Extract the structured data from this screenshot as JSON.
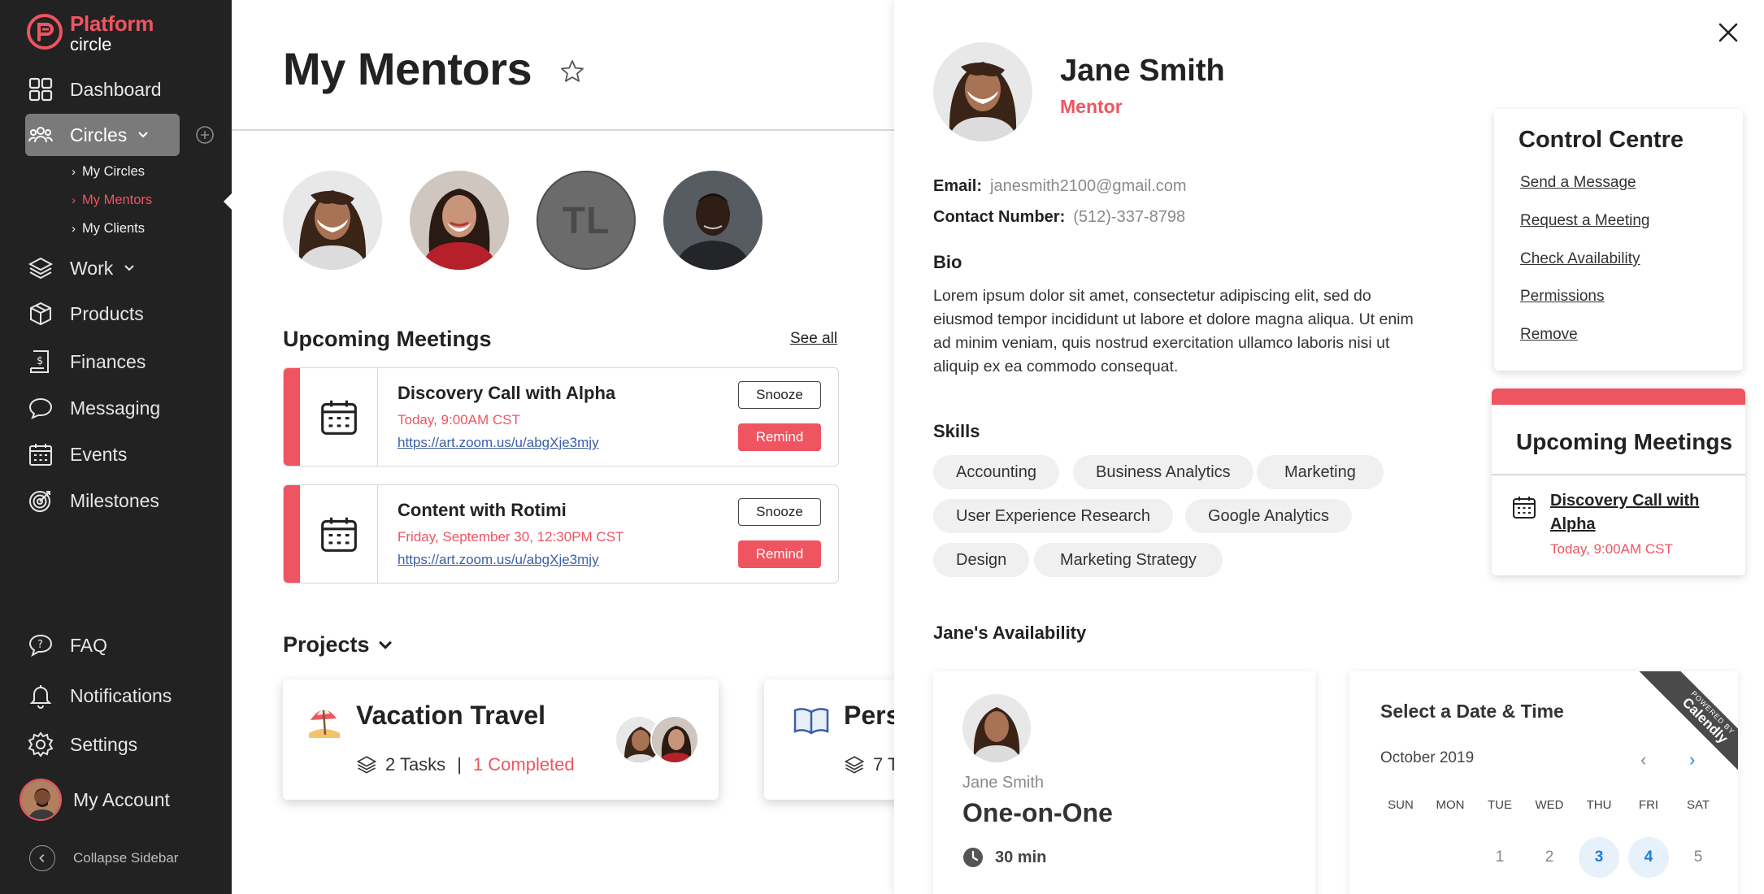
{
  "brand": {
    "name_line1": "Platform",
    "name_line2": "circle",
    "accent": "#ef5461"
  },
  "sidebar": {
    "items": [
      {
        "label": "Dashboard",
        "icon": "dashboard-icon"
      },
      {
        "label": "Circles",
        "icon": "people-icon"
      },
      {
        "label": "Work",
        "icon": "layers-icon"
      },
      {
        "label": "Products",
        "icon": "box-icon"
      },
      {
        "label": "Finances",
        "icon": "invoice-icon"
      },
      {
        "label": "Messaging",
        "icon": "chat-icon"
      },
      {
        "label": "Events",
        "icon": "calendar-icon"
      },
      {
        "label": "Milestones",
        "icon": "target-icon"
      }
    ],
    "sub_items": [
      "My Circles",
      "My Mentors",
      "My Clients"
    ],
    "bottom_items": [
      {
        "label": "FAQ",
        "icon": "question-icon"
      },
      {
        "label": "Notifications",
        "icon": "bell-icon"
      },
      {
        "label": "Settings",
        "icon": "gear-icon"
      },
      {
        "label": "My Account",
        "icon": "avatar"
      }
    ],
    "collapse_label": "Collapse Sidebar"
  },
  "main": {
    "title": "My Mentors",
    "mentor_initials": "TL",
    "upcoming_heading": "Upcoming Meetings",
    "see_all": "See all",
    "meetings": [
      {
        "title": "Discovery Call with Alpha",
        "time": "Today, 9:00AM CST",
        "link": "https://art.zoom.us/u/abgXje3mjy",
        "snooze": "Snooze",
        "remind": "Remind"
      },
      {
        "title": "Content with Rotimi",
        "time": "Friday, September 30, 12:30PM CST",
        "link": "https://art.zoom.us/u/abgXje3mjy",
        "snooze": "Snooze",
        "remind": "Remind"
      }
    ],
    "projects_heading": "Projects",
    "projects": [
      {
        "title": "Vacation Travel",
        "tasks": "2 Tasks",
        "separator": "|",
        "completed": "1 Completed",
        "emoji": "umbrella-beach-icon"
      },
      {
        "title": "Pers",
        "tasks": "7 T",
        "emoji": "book-icon"
      }
    ]
  },
  "panel": {
    "name": "Jane Smith",
    "role": "Mentor",
    "email_label": "Email:",
    "email": "janesmith2100@gmail.com",
    "contact_label": "Contact Number:",
    "contact": "(512)-337-8798",
    "bio_heading": "Bio",
    "bio": "Lorem ipsum dolor sit amet, consectetur adipiscing elit, sed do eiusmod tempor incididunt ut labore et dolore magna aliqua. Ut enim ad minim veniam, quis nostrud exercitation ullamco laboris nisi ut aliquip ex ea commodo consequat.",
    "skills_heading": "Skills",
    "skills": [
      "Accounting",
      "Business Analytics",
      "Marketing",
      "User Experience Research",
      "Google Analytics",
      "Design",
      "Marketing Strategy"
    ],
    "availability_heading": "Jane's Availability",
    "control_centre": {
      "title": "Control Centre",
      "links": [
        "Send a Message",
        "Request a Meeting",
        "Check Availability",
        "Permissions",
        "Remove"
      ]
    },
    "upcoming": {
      "title": "Upcoming Meetings",
      "meeting_title": "Discovery Call with Alpha",
      "meeting_time": "Today, 9:00AM CST"
    },
    "availability": {
      "name": "Jane Smith",
      "event_title": "One-on-One",
      "duration": "30 min"
    },
    "calendar": {
      "title": "Select a Date & Time",
      "month": "October 2019",
      "prev": "‹",
      "next": "›",
      "weekdays": [
        "SUN",
        "MON",
        "TUE",
        "WED",
        "THU",
        "FRI",
        "SAT"
      ],
      "week1": [
        "",
        "",
        "1",
        "2",
        "3",
        "4",
        "5"
      ],
      "available_days": [
        "3",
        "4"
      ],
      "ribbon_top": "POWERED BY",
      "ribbon_brand": "Calendly"
    }
  }
}
